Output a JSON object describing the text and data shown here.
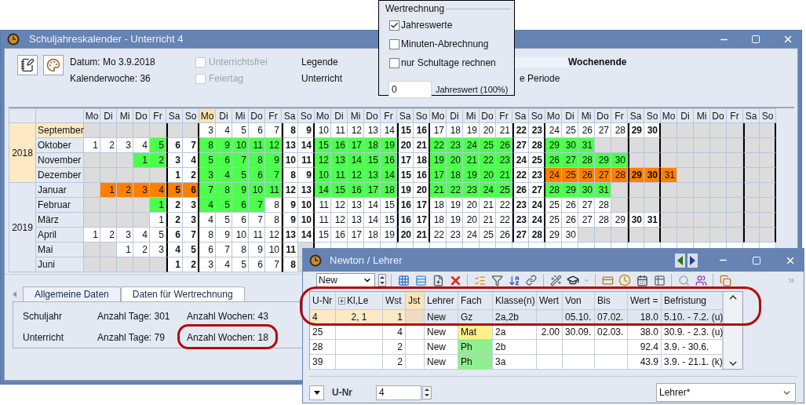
{
  "window": {
    "title": "Schuljahreskalender - Unterricht 4"
  },
  "info": {
    "date": "Datum: Mo 3.9.2018",
    "week": "Kalenderwoche: 36",
    "checkboxes": [
      {
        "label": "Unterrichtsfrei",
        "checked": false,
        "disabled": true
      },
      {
        "label": "Feiertag",
        "checked": false,
        "disabled": true
      }
    ]
  },
  "legend": {
    "title": "Legende",
    "unterricht": "Unterricht",
    "periode": "e Periode",
    "wochenende": "Wochenende"
  },
  "calc_popup": {
    "title": "Wertrechnung",
    "options": [
      {
        "label": "Jahreswerte",
        "checked": true
      },
      {
        "label": "Minuten-Abrechnung",
        "checked": false
      },
      {
        "label": "nur Schultage rechnen",
        "checked": false
      }
    ],
    "value": "0",
    "value_label": "Jahreswert (100%)"
  },
  "calendar": {
    "weekdays": [
      {
        "label": "Mo",
        "selected": false
      },
      {
        "label": "Di",
        "selected": false
      },
      {
        "label": "Mi",
        "selected": false
      },
      {
        "label": "Do",
        "selected": false
      },
      {
        "label": "Fr",
        "selected": false
      },
      {
        "label": "Sa",
        "selected": false
      },
      {
        "label": "So",
        "selected": false
      },
      {
        "label": "Mo",
        "selected": true
      },
      {
        "label": "Di",
        "selected": false
      },
      {
        "label": "Mi",
        "selected": false
      },
      {
        "label": "Do",
        "selected": false
      },
      {
        "label": "Fr",
        "selected": false
      },
      {
        "label": "Sa",
        "selected": false
      },
      {
        "label": "So",
        "selected": false
      },
      {
        "label": "Mo",
        "selected": false
      },
      {
        "label": "Di",
        "selected": false
      },
      {
        "label": "Mi",
        "selected": false
      },
      {
        "label": "Do",
        "selected": false
      },
      {
        "label": "Fr",
        "selected": false
      },
      {
        "label": "Sa",
        "selected": false
      },
      {
        "label": "So",
        "selected": false
      },
      {
        "label": "Mo",
        "selected": false
      },
      {
        "label": "Di",
        "selected": false
      },
      {
        "label": "Mi",
        "selected": false
      },
      {
        "label": "Do",
        "selected": false
      },
      {
        "label": "Fr",
        "selected": false
      },
      {
        "label": "Sa",
        "selected": false
      },
      {
        "label": "So",
        "selected": false
      },
      {
        "label": "Mo",
        "selected": false
      },
      {
        "label": "Di",
        "selected": false
      },
      {
        "label": "Mi",
        "selected": false
      },
      {
        "label": "Do",
        "selected": false
      },
      {
        "label": "Fr",
        "selected": false
      },
      {
        "label": "Sa",
        "selected": false
      },
      {
        "label": "So",
        "selected": false
      },
      {
        "label": "Mo",
        "selected": false
      },
      {
        "label": "Di",
        "selected": false
      },
      {
        "label": "Mi",
        "selected": false
      },
      {
        "label": "Do",
        "selected": false
      },
      {
        "label": "Fr",
        "selected": false
      },
      {
        "label": "Sa",
        "selected": false
      },
      {
        "label": "So",
        "selected": false
      }
    ],
    "years": [
      {
        "label": "2018",
        "selected": true,
        "months": [
          {
            "name": "September",
            "selected": true,
            "cells": [
              null,
              null,
              null,
              null,
              null,
              null,
              null,
              {
                "day": "3",
                "kind": "plain"
              },
              {
                "day": "4",
                "kind": "plain"
              },
              {
                "day": "5",
                "kind": "plain"
              },
              {
                "day": "6",
                "kind": "plain"
              },
              {
                "day": "7",
                "kind": "plain"
              },
              {
                "day": "8",
                "kind": "plain"
              },
              {
                "day": "9",
                "kind": "plain"
              },
              {
                "day": "10",
                "kind": "plain"
              },
              {
                "day": "11",
                "kind": "plain"
              },
              {
                "day": "12",
                "kind": "plain"
              },
              {
                "day": "13",
                "kind": "plain"
              },
              {
                "day": "14",
                "kind": "plain"
              },
              {
                "day": "15",
                "kind": "plain"
              },
              {
                "day": "16",
                "kind": "plain"
              },
              {
                "day": "17",
                "kind": "plain"
              },
              {
                "day": "18",
                "kind": "plain"
              },
              {
                "day": "19",
                "kind": "plain"
              },
              {
                "day": "20",
                "kind": "plain"
              },
              {
                "day": "21",
                "kind": "plain"
              },
              {
                "day": "22",
                "kind": "plain"
              },
              {
                "day": "23",
                "kind": "plain"
              },
              {
                "day": "24",
                "kind": "plain"
              },
              {
                "day": "25",
                "kind": "plain"
              },
              {
                "day": "26",
                "kind": "plain"
              },
              {
                "day": "27",
                "kind": "plain"
              },
              {
                "day": "28",
                "kind": "plain"
              },
              {
                "day": "29",
                "kind": "plain"
              },
              {
                "day": "30",
                "kind": "plain"
              }
            ]
          },
          {
            "name": "Oktober",
            "selected": false,
            "cells": [
              {
                "day": "1",
                "kind": "plain"
              },
              {
                "day": "2",
                "kind": "plain"
              },
              {
                "day": "3",
                "kind": "plain"
              },
              {
                "day": "4",
                "kind": "plain"
              },
              {
                "day": "5",
                "kind": "lesson"
              },
              {
                "day": "6",
                "kind": "plain"
              },
              {
                "day": "7",
                "kind": "plain"
              },
              {
                "day": "8",
                "kind": "lesson"
              },
              {
                "day": "9",
                "kind": "lesson"
              },
              {
                "day": "10",
                "kind": "lesson"
              },
              {
                "day": "11",
                "kind": "lesson"
              },
              {
                "day": "12",
                "kind": "lesson"
              },
              {
                "day": "13",
                "kind": "plain"
              },
              {
                "day": "14",
                "kind": "plain"
              },
              {
                "day": "15",
                "kind": "lesson"
              },
              {
                "day": "16",
                "kind": "lesson"
              },
              {
                "day": "17",
                "kind": "lesson"
              },
              {
                "day": "18",
                "kind": "lesson"
              },
              {
                "day": "19",
                "kind": "lesson"
              },
              {
                "day": "20",
                "kind": "plain"
              },
              {
                "day": "21",
                "kind": "plain"
              },
              {
                "day": "22",
                "kind": "lesson"
              },
              {
                "day": "23",
                "kind": "lesson"
              },
              {
                "day": "24",
                "kind": "lesson"
              },
              {
                "day": "25",
                "kind": "lesson"
              },
              {
                "day": "26",
                "kind": "lesson"
              },
              {
                "day": "27",
                "kind": "plain"
              },
              {
                "day": "28",
                "kind": "plain"
              },
              {
                "day": "29",
                "kind": "lesson"
              },
              {
                "day": "30",
                "kind": "lesson"
              },
              {
                "day": "31",
                "kind": "lesson"
              }
            ]
          },
          {
            "name": "November",
            "selected": false,
            "cells": [
              null,
              null,
              null,
              {
                "day": "1",
                "kind": "lesson"
              },
              {
                "day": "2",
                "kind": "lesson"
              },
              {
                "day": "3",
                "kind": "plain"
              },
              {
                "day": "4",
                "kind": "plain"
              },
              {
                "day": "5",
                "kind": "lesson"
              },
              {
                "day": "6",
                "kind": "lesson"
              },
              {
                "day": "7",
                "kind": "lesson"
              },
              {
                "day": "8",
                "kind": "lesson"
              },
              {
                "day": "9",
                "kind": "lesson"
              },
              {
                "day": "10",
                "kind": "plain"
              },
              {
                "day": "11",
                "kind": "plain"
              },
              {
                "day": "12",
                "kind": "lesson"
              },
              {
                "day": "13",
                "kind": "lesson"
              },
              {
                "day": "14",
                "kind": "lesson"
              },
              {
                "day": "15",
                "kind": "lesson"
              },
              {
                "day": "16",
                "kind": "lesson"
              },
              {
                "day": "17",
                "kind": "plain"
              },
              {
                "day": "18",
                "kind": "plain"
              },
              {
                "day": "19",
                "kind": "lesson"
              },
              {
                "day": "20",
                "kind": "lesson"
              },
              {
                "day": "21",
                "kind": "lesson"
              },
              {
                "day": "22",
                "kind": "lesson"
              },
              {
                "day": "23",
                "kind": "lesson"
              },
              {
                "day": "24",
                "kind": "plain"
              },
              {
                "day": "25",
                "kind": "plain"
              },
              {
                "day": "26",
                "kind": "lesson"
              },
              {
                "day": "27",
                "kind": "lesson"
              },
              {
                "day": "28",
                "kind": "lesson"
              },
              {
                "day": "29",
                "kind": "lesson"
              },
              {
                "day": "30",
                "kind": "lesson"
              }
            ]
          },
          {
            "name": "Dezember",
            "selected": false,
            "cells": [
              null,
              null,
              null,
              null,
              null,
              {
                "day": "1",
                "kind": "plain"
              },
              {
                "day": "2",
                "kind": "plain"
              },
              {
                "day": "3",
                "kind": "lesson"
              },
              {
                "day": "4",
                "kind": "lesson"
              },
              {
                "day": "5",
                "kind": "lesson"
              },
              {
                "day": "6",
                "kind": "lesson"
              },
              {
                "day": "7",
                "kind": "lesson"
              },
              {
                "day": "8",
                "kind": "plain"
              },
              {
                "day": "9",
                "kind": "plain"
              },
              {
                "day": "10",
                "kind": "lesson"
              },
              {
                "day": "11",
                "kind": "lesson"
              },
              {
                "day": "12",
                "kind": "lesson"
              },
              {
                "day": "13",
                "kind": "lesson"
              },
              {
                "day": "14",
                "kind": "lesson"
              },
              {
                "day": "15",
                "kind": "plain"
              },
              {
                "day": "16",
                "kind": "plain"
              },
              {
                "day": "17",
                "kind": "lesson"
              },
              {
                "day": "18",
                "kind": "lesson"
              },
              {
                "day": "19",
                "kind": "lesson"
              },
              {
                "day": "20",
                "kind": "lesson"
              },
              {
                "day": "21",
                "kind": "lesson"
              },
              {
                "day": "22",
                "kind": "plain"
              },
              {
                "day": "23",
                "kind": "plain"
              },
              {
                "day": "24",
                "kind": "holiday"
              },
              {
                "day": "25",
                "kind": "holiday"
              },
              {
                "day": "26",
                "kind": "holiday"
              },
              {
                "day": "27",
                "kind": "holiday"
              },
              {
                "day": "28",
                "kind": "holiday"
              },
              {
                "day": "29",
                "kind": "holiday"
              },
              {
                "day": "30",
                "kind": "holiday"
              },
              {
                "day": "31",
                "kind": "holiday"
              }
            ]
          }
        ]
      },
      {
        "label": "2019",
        "selected": false,
        "months": [
          {
            "name": "Januar",
            "selected": false,
            "cells": [
              null,
              {
                "day": "1",
                "kind": "holiday"
              },
              {
                "day": "2",
                "kind": "holiday"
              },
              {
                "day": "3",
                "kind": "holiday"
              },
              {
                "day": "4",
                "kind": "holiday"
              },
              {
                "day": "5",
                "kind": "holiday"
              },
              {
                "day": "6",
                "kind": "holiday"
              },
              {
                "day": "7",
                "kind": "lesson"
              },
              {
                "day": "8",
                "kind": "lesson"
              },
              {
                "day": "9",
                "kind": "lesson"
              },
              {
                "day": "10",
                "kind": "lesson"
              },
              {
                "day": "11",
                "kind": "lesson"
              },
              {
                "day": "12",
                "kind": "plain"
              },
              {
                "day": "13",
                "kind": "plain"
              },
              {
                "day": "14",
                "kind": "lesson"
              },
              {
                "day": "15",
                "kind": "lesson"
              },
              {
                "day": "16",
                "kind": "lesson"
              },
              {
                "day": "17",
                "kind": "lesson"
              },
              {
                "day": "18",
                "kind": "lesson"
              },
              {
                "day": "19",
                "kind": "plain"
              },
              {
                "day": "20",
                "kind": "plain"
              },
              {
                "day": "21",
                "kind": "lesson"
              },
              {
                "day": "22",
                "kind": "lesson"
              },
              {
                "day": "23",
                "kind": "lesson"
              },
              {
                "day": "24",
                "kind": "lesson"
              },
              {
                "day": "25",
                "kind": "lesson"
              },
              {
                "day": "26",
                "kind": "plain"
              },
              {
                "day": "27",
                "kind": "plain"
              },
              {
                "day": "28",
                "kind": "lesson"
              },
              {
                "day": "29",
                "kind": "lesson"
              },
              {
                "day": "30",
                "kind": "lesson"
              },
              {
                "day": "31",
                "kind": "lesson"
              }
            ]
          },
          {
            "name": "Februar",
            "selected": false,
            "cells": [
              null,
              null,
              null,
              null,
              {
                "day": "1",
                "kind": "lesson"
              },
              {
                "day": "2",
                "kind": "plain"
              },
              {
                "day": "3",
                "kind": "plain"
              },
              {
                "day": "4",
                "kind": "lesson"
              },
              {
                "day": "5",
                "kind": "lesson"
              },
              {
                "day": "6",
                "kind": "lesson"
              },
              {
                "day": "7",
                "kind": "lesson"
              },
              {
                "day": "8",
                "kind": "plain"
              },
              {
                "day": "9",
                "kind": "plain"
              },
              {
                "day": "10",
                "kind": "plain"
              },
              {
                "day": "11",
                "kind": "plain"
              },
              {
                "day": "12",
                "kind": "plain"
              },
              {
                "day": "13",
                "kind": "plain"
              },
              {
                "day": "14",
                "kind": "plain"
              },
              {
                "day": "15",
                "kind": "plain"
              },
              {
                "day": "16",
                "kind": "plain"
              },
              {
                "day": "17",
                "kind": "plain"
              },
              {
                "day": "18",
                "kind": "plain"
              },
              {
                "day": "19",
                "kind": "plain"
              },
              {
                "day": "20",
                "kind": "plain"
              },
              {
                "day": "21",
                "kind": "plain"
              },
              {
                "day": "22",
                "kind": "plain"
              },
              {
                "day": "23",
                "kind": "plain"
              },
              {
                "day": "24",
                "kind": "plain"
              },
              {
                "day": "25",
                "kind": "plain"
              },
              {
                "day": "26",
                "kind": "plain"
              },
              {
                "day": "27",
                "kind": "plain"
              },
              {
                "day": "28",
                "kind": "plain"
              }
            ]
          },
          {
            "name": "März",
            "selected": false,
            "cells": [
              null,
              null,
              null,
              null,
              {
                "day": "1",
                "kind": "plain"
              },
              {
                "day": "2",
                "kind": "plain"
              },
              {
                "day": "3",
                "kind": "plain"
              },
              {
                "day": "4",
                "kind": "plain"
              },
              {
                "day": "5",
                "kind": "plain"
              },
              {
                "day": "6",
                "kind": "plain"
              },
              {
                "day": "7",
                "kind": "plain"
              },
              {
                "day": "8",
                "kind": "plain"
              },
              {
                "day": "9",
                "kind": "plain"
              },
              {
                "day": "10",
                "kind": "plain"
              },
              {
                "day": "11",
                "kind": "plain"
              },
              {
                "day": "12",
                "kind": "plain"
              },
              {
                "day": "13",
                "kind": "plain"
              },
              {
                "day": "14",
                "kind": "plain"
              },
              {
                "day": "15",
                "kind": "plain"
              },
              {
                "day": "16",
                "kind": "plain"
              },
              {
                "day": "17",
                "kind": "plain"
              },
              {
                "day": "18",
                "kind": "plain"
              },
              {
                "day": "19",
                "kind": "plain"
              },
              {
                "day": "20",
                "kind": "plain"
              },
              {
                "day": "21",
                "kind": "plain"
              },
              {
                "day": "22",
                "kind": "plain"
              },
              {
                "day": "23",
                "kind": "plain"
              },
              {
                "day": "24",
                "kind": "plain"
              },
              {
                "day": "25",
                "kind": "plain"
              },
              {
                "day": "26",
                "kind": "plain"
              },
              {
                "day": "27",
                "kind": "plain"
              },
              {
                "day": "28",
                "kind": "plain"
              },
              {
                "day": "29",
                "kind": "plain"
              },
              {
                "day": "30",
                "kind": "plain"
              },
              {
                "day": "31",
                "kind": "plain"
              }
            ]
          },
          {
            "name": "April",
            "selected": false,
            "cells": [
              {
                "day": "1",
                "kind": "plain"
              },
              {
                "day": "2",
                "kind": "plain"
              },
              {
                "day": "3",
                "kind": "plain"
              },
              {
                "day": "4",
                "kind": "plain"
              },
              {
                "day": "5",
                "kind": "plain"
              },
              {
                "day": "6",
                "kind": "plain"
              },
              {
                "day": "7",
                "kind": "plain"
              },
              {
                "day": "8",
                "kind": "plain"
              },
              {
                "day": "9",
                "kind": "plain"
              },
              {
                "day": "10",
                "kind": "plain"
              },
              {
                "day": "11",
                "kind": "plain"
              },
              {
                "day": "12",
                "kind": "plain"
              },
              {
                "day": "13",
                "kind": "plain"
              },
              {
                "day": "14",
                "kind": "plain"
              },
              {
                "day": "15",
                "kind": "plain"
              },
              {
                "day": "16",
                "kind": "plain"
              },
              {
                "day": "17",
                "kind": "plain"
              },
              {
                "day": "18",
                "kind": "plain"
              },
              {
                "day": "19",
                "kind": "plain"
              },
              {
                "day": "20",
                "kind": "plain"
              },
              {
                "day": "21",
                "kind": "plain"
              },
              {
                "day": "22",
                "kind": "plain"
              },
              {
                "day": "23",
                "kind": "plain"
              },
              {
                "day": "24",
                "kind": "plain"
              },
              {
                "day": "25",
                "kind": "plain"
              },
              {
                "day": "26",
                "kind": "plain"
              },
              {
                "day": "27",
                "kind": "plain"
              },
              {
                "day": "28",
                "kind": "plain"
              },
              {
                "day": "29",
                "kind": "plain"
              },
              {
                "day": "30",
                "kind": "plain"
              }
            ]
          },
          {
            "name": "Mai",
            "selected": false,
            "cells": [
              null,
              null,
              {
                "day": "1",
                "kind": "plain"
              },
              {
                "day": "2",
                "kind": "plain"
              },
              {
                "day": "3",
                "kind": "plain"
              },
              {
                "day": "4",
                "kind": "plain"
              },
              {
                "day": "5",
                "kind": "plain"
              },
              {
                "day": "6",
                "kind": "plain"
              },
              {
                "day": "7",
                "kind": "plain"
              },
              {
                "day": "8",
                "kind": "plain"
              },
              {
                "day": "9",
                "kind": "plain"
              },
              {
                "day": "10",
                "kind": "plain"
              },
              {
                "day": "11",
                "kind": "plain"
              }
            ]
          },
          {
            "name": "Juni",
            "selected": false,
            "cells": [
              null,
              null,
              null,
              null,
              null,
              {
                "day": "1",
                "kind": "plain"
              },
              {
                "day": "2",
                "kind": "plain"
              },
              {
                "day": "3",
                "kind": "plain"
              },
              {
                "day": "4",
                "kind": "plain"
              },
              {
                "day": "5",
                "kind": "plain"
              },
              {
                "day": "6",
                "kind": "plain"
              },
              {
                "day": "7",
                "kind": "plain"
              },
              {
                "day": "8",
                "kind": "plain"
              }
            ]
          }
        ]
      }
    ]
  },
  "tabs": [
    {
      "label": "Allgemeine Daten",
      "selected": false
    },
    {
      "label": "Daten für Wertrechnung",
      "selected": true
    }
  ],
  "stats": [
    {
      "label": "Schuljahr",
      "days": "Anzahl Tage: 301",
      "weeks": "Anzahl Wochen: 43"
    },
    {
      "label": "Unterricht",
      "days": "Anzahl Tage: 79",
      "weeks": "Anzahl Wochen: 18"
    }
  ],
  "newton": {
    "title": "Newton / Lehrer",
    "filter": "New",
    "columns": [
      {
        "label": "U-Nr",
        "expandable": false,
        "selected": false
      },
      {
        "label": "Kl,Le",
        "expandable": true,
        "selected": false
      },
      {
        "label": "Wst",
        "expandable": false,
        "selected": false
      },
      {
        "label": "Jst",
        "expandable": false,
        "selected": true
      },
      {
        "label": "Lehrer",
        "expandable": false,
        "selected": false
      },
      {
        "label": "Fach",
        "expandable": false,
        "selected": false
      },
      {
        "label": "Klasse(n)",
        "expandable": false,
        "selected": false
      },
      {
        "label": "Wert",
        "expandable": false,
        "selected": false
      },
      {
        "label": "Von",
        "expandable": false,
        "selected": false
      },
      {
        "label": "Bis",
        "expandable": false,
        "selected": false
      },
      {
        "label": "Wert =",
        "expandable": false,
        "selected": false
      },
      {
        "label": "Befristung",
        "expandable": false,
        "selected": false
      }
    ],
    "rows": [
      {
        "selected": true,
        "cells": [
          "4",
          "2, 1",
          "1",
          "",
          "New",
          "Gz",
          "2a,2b",
          "",
          "05.10.",
          "07.02.",
          "18.0",
          "5.10. - 7.2. (u)"
        ]
      },
      {
        "selected": false,
        "color": "#fff08c",
        "cells": [
          "25",
          "",
          "4",
          "",
          "New",
          "Mat",
          "2a",
          "2.00",
          "30.09.",
          "02.03.",
          "38.0",
          "30.9. - 2.3. (u)"
        ]
      },
      {
        "selected": false,
        "color": "#8ef08e",
        "cells": [
          "28",
          "",
          "2",
          "",
          "New",
          "Ph",
          "2b",
          "",
          "",
          "",
          "92.4",
          "3.9. - 30.6."
        ]
      },
      {
        "selected": false,
        "color": "#8ef08e",
        "cells": [
          "39",
          "",
          "2",
          "",
          "New",
          "Ph",
          "3a",
          "",
          "",
          "",
          "43.9",
          "3.9. - 21.1. (k)"
        ]
      }
    ],
    "footer": {
      "label": "U-Nr",
      "value": "4",
      "view": "Lehrer*"
    }
  }
}
